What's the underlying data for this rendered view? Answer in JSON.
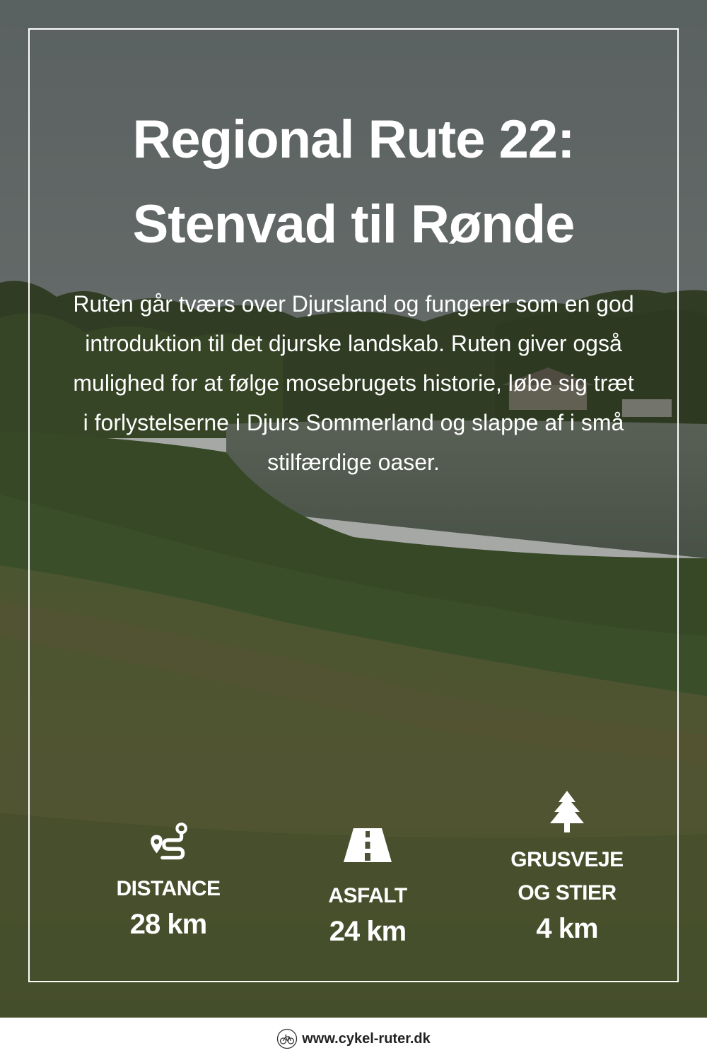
{
  "title_line1": "Regional Rute 22:",
  "title_line2": "Stenvad til Rønde",
  "description": "Ruten går tværs over Djursland og fungerer som en god introduktion til det djurske landskab. Ruten giver også mulighed for at følge mosebrugets historie, løbe sig træt i forlystelserne i Djurs Sommerland og slappe af i små stilfærdige oaser.",
  "stats": [
    {
      "icon": "route-icon",
      "label_lines": [
        "DISTANCE"
      ],
      "value": "28 km"
    },
    {
      "icon": "road-icon",
      "label_lines": [
        "ASFALT"
      ],
      "value": "24 km"
    },
    {
      "icon": "tree-icon",
      "label_lines": [
        "GRUSVEJE",
        "OG STIER"
      ],
      "value": "4 km"
    }
  ],
  "footer": {
    "logo_icon": "bicycle-icon",
    "url": "www.cykel-ruter.dk"
  },
  "colors": {
    "text": "#ffffff",
    "overlay": "#3a4238",
    "grass": "#5d6a2d",
    "footer_text": "#222222"
  }
}
